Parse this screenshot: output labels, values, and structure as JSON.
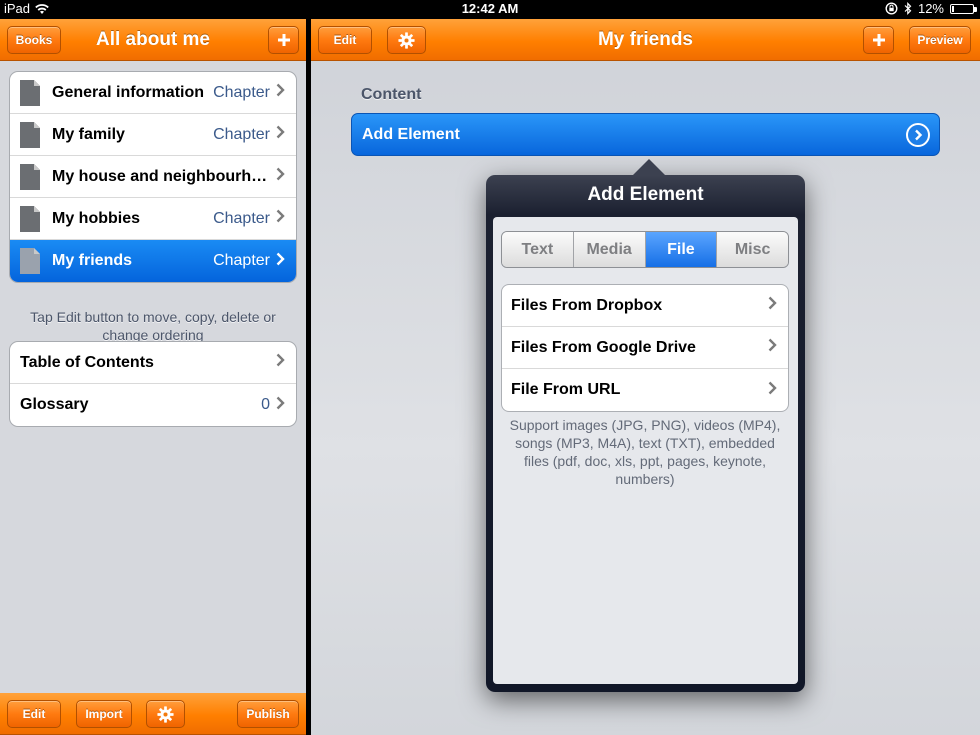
{
  "status_bar": {
    "carrier": "iPad",
    "time": "12:42 AM",
    "battery": "12%",
    "battery_level": 0.12
  },
  "left": {
    "books_button": "Books",
    "title": "All about me",
    "chapters": [
      {
        "title": "General information",
        "detail": "Chapter",
        "selected": false
      },
      {
        "title": "My family",
        "detail": "Chapter",
        "selected": false
      },
      {
        "title": "My house and neighbourhood",
        "detail": "",
        "selected": false
      },
      {
        "title": "My hobbies",
        "detail": "Chapter",
        "selected": false
      },
      {
        "title": "My friends",
        "detail": "Chapter",
        "selected": true
      }
    ],
    "hint": "Tap Edit button to move, copy, delete or change ordering",
    "extras": [
      {
        "title": "Table of Contents",
        "detail": ""
      },
      {
        "title": "Glossary",
        "detail": "0"
      }
    ],
    "toolbar": {
      "edit": "Edit",
      "import": "Import",
      "publish": "Publish"
    }
  },
  "right": {
    "edit_button": "Edit",
    "title": "My friends",
    "preview_button": "Preview",
    "content_label": "Content",
    "add_element_label": "Add Element"
  },
  "popover": {
    "title": "Add Element",
    "tabs": [
      {
        "label": "Text",
        "active": false
      },
      {
        "label": "Media",
        "active": false
      },
      {
        "label": "File",
        "active": true
      },
      {
        "label": "Misc",
        "active": false
      }
    ],
    "items": [
      "Files From Dropbox",
      "Files From Google Drive",
      "File From URL"
    ],
    "support_text": "Support images (JPG, PNG), videos (MP4), songs (MP3, M4A), text (TXT), embedded files (pdf, doc, xls, ppt, pages, keynote, numbers)"
  },
  "colors": {
    "orange": "#ff7f00",
    "selection_blue": "#0a6fe3",
    "popover_dark": "#1b2030"
  }
}
